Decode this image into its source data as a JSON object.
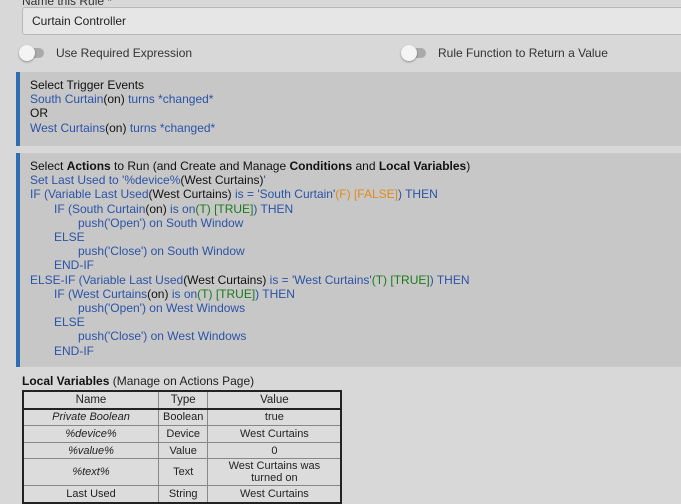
{
  "name_label": "Name this Rule *",
  "rule_name": "Curtain Controller",
  "toggles": {
    "required_expression": "Use Required Expression",
    "rule_function": "Rule Function to Return a Value"
  },
  "trigger": {
    "title": "Select Trigger Events",
    "line1_device": "South Curtain",
    "line1_state": "(on)",
    "line1_rest": " turns *changed*",
    "or": "OR",
    "line2_device": "West Curtains",
    "line2_state": "(on)",
    "line2_rest": " turns *changed*"
  },
  "actions": {
    "title_1": "Select ",
    "title_actions": "Actions",
    "title_2": " to Run (and Create and Manage ",
    "title_conditions": "Conditions",
    "title_3": " and ",
    "title_local": "Local Variables",
    "title_4": ")",
    "l1a": "Set Last Used to '%device%",
    "l1b": "(West Curtains)",
    "l1c": "'",
    "l2a": "IF (Variable Last Used",
    "l2b": "(West Curtains)",
    "l2c": " is = 'South Curtain'",
    "l2d": "(F) [FALSE]",
    "l2e": ") THEN",
    "l3a": "IF (South Curtain",
    "l3b": "(on)",
    "l3c": " is on",
    "l3d": "(T) [TRUE]",
    "l3e": ") THEN",
    "l4": "push('Open') on South Window",
    "l5": "ELSE",
    "l6": "push('Close') on South Window",
    "l7": "END-IF",
    "l8a": "ELSE-IF (Variable Last Used",
    "l8b": "(West Curtains)",
    "l8c": " is = 'West Curtains'",
    "l8d": "(T) [TRUE]",
    "l8e": ") THEN",
    "l9a": "IF (West Curtains",
    "l9b": "(on)",
    "l9c": " is on",
    "l9d": "(T) [TRUE]",
    "l9e": ") THEN",
    "l10": "push('Open') on West Windows",
    "l11": "ELSE",
    "l12": "push('Close') on West Windows",
    "l13": "END-IF"
  },
  "local_vars": {
    "title_bold": "Local Variables",
    "title_rest": " (Manage on Actions Page)",
    "headers": [
      "Name",
      "Type",
      "Value"
    ],
    "rows": [
      [
        "Private Boolean",
        "Boolean",
        "true"
      ],
      [
        "%device%",
        "Device",
        "West Curtains"
      ],
      [
        "%value%",
        "Value",
        "0"
      ],
      [
        "%text%",
        "Text",
        "West Curtains was turned on"
      ],
      [
        "Last Used",
        "String",
        "West Curtains"
      ]
    ]
  },
  "colors": {
    "accent": "#2f6db5",
    "link": "#2b53a7",
    "true": "#1c7a1c",
    "false": "#e08b1a"
  }
}
